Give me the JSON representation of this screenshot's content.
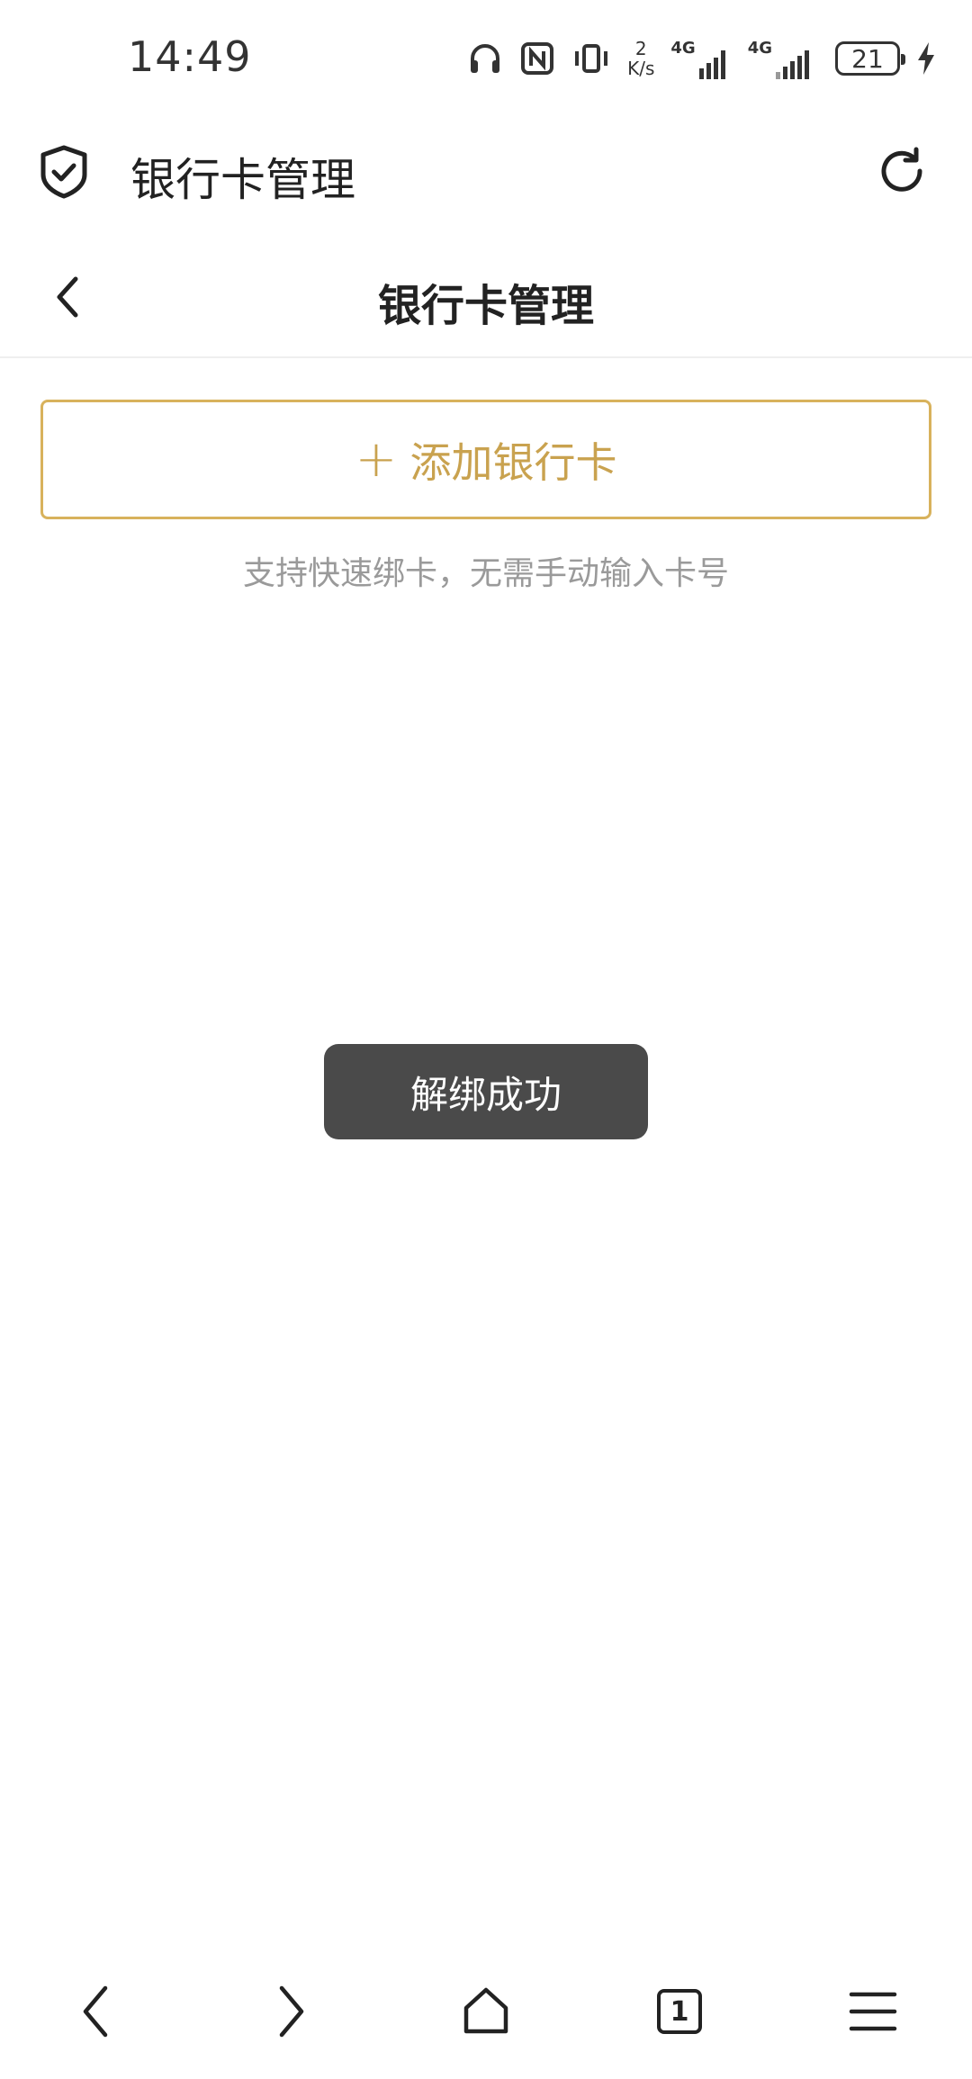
{
  "status_bar": {
    "time": "14:49",
    "net_speed_value": "2",
    "net_speed_unit": "K/s",
    "sim1_label": "4G",
    "sim2_label": "4G",
    "battery": "21"
  },
  "browser_header": {
    "title": "银行卡管理"
  },
  "page": {
    "title": "银行卡管理",
    "add_card_label": "添加银行卡",
    "hint": "支持快速绑卡，无需手动输入卡号"
  },
  "toast": {
    "message": "解绑成功"
  },
  "bottom_nav": {
    "tab_count": "1"
  },
  "colors": {
    "accent": "#c9a24f",
    "accent_border": "#d8b25c",
    "toast_bg": "#4a4a4a"
  }
}
